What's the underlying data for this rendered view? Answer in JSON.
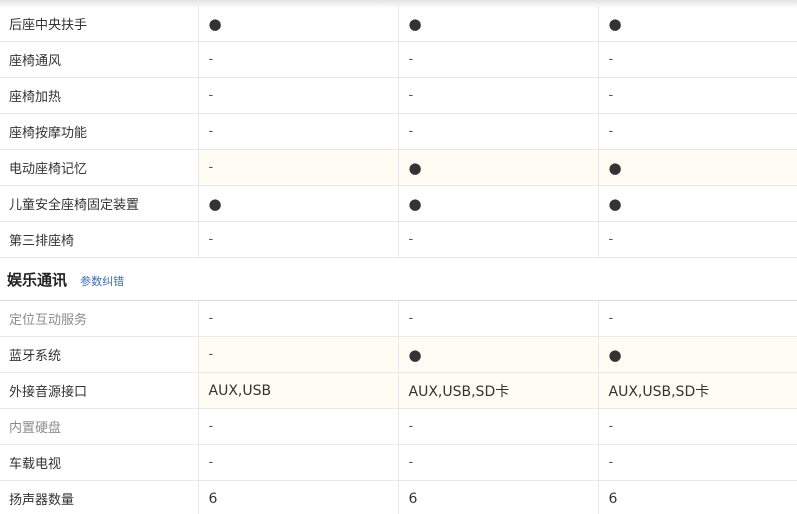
{
  "columns": 3,
  "rows_before": [
    {
      "label": "后座中央扶手",
      "values": [
        "●",
        "●",
        "●"
      ]
    },
    {
      "label": "座椅通风",
      "values": [
        "-",
        "-",
        "-"
      ]
    },
    {
      "label": "座椅加热",
      "values": [
        "-",
        "-",
        "-"
      ]
    },
    {
      "label": "座椅按摩功能",
      "values": [
        "-",
        "-",
        "-"
      ]
    },
    {
      "label": "电动座椅记忆",
      "values": [
        "-",
        "●",
        "●"
      ]
    },
    {
      "label": "儿童安全座椅固定装置",
      "values": [
        "●",
        "●",
        "●"
      ]
    },
    {
      "label": "第三排座椅",
      "values": [
        "-",
        "-",
        "-"
      ]
    }
  ],
  "section": {
    "title": "娱乐通讯",
    "link": "参数纠错"
  },
  "rows_after": [
    {
      "label": "定位互动服务",
      "values": [
        "-",
        "-",
        "-"
      ]
    },
    {
      "label": "蓝牙系统",
      "values": [
        "-",
        "●",
        "●"
      ]
    },
    {
      "label": "外接音源接口",
      "values": [
        "AUX,USB",
        "AUX,USB,SD卡",
        "AUX,USB,SD卡"
      ]
    },
    {
      "label": "内置硬盘",
      "values": [
        "-",
        "-",
        "-"
      ]
    },
    {
      "label": "车载电视",
      "values": [
        "-",
        "-",
        "-"
      ]
    },
    {
      "label": "扬声器数量",
      "values": [
        "6",
        "6",
        "6"
      ]
    }
  ],
  "colors": {
    "highlight_row": "#fffdf3",
    "border": "#e8e8e8",
    "link": "#3a6fb3",
    "muted_label": "#8c8c8c"
  }
}
